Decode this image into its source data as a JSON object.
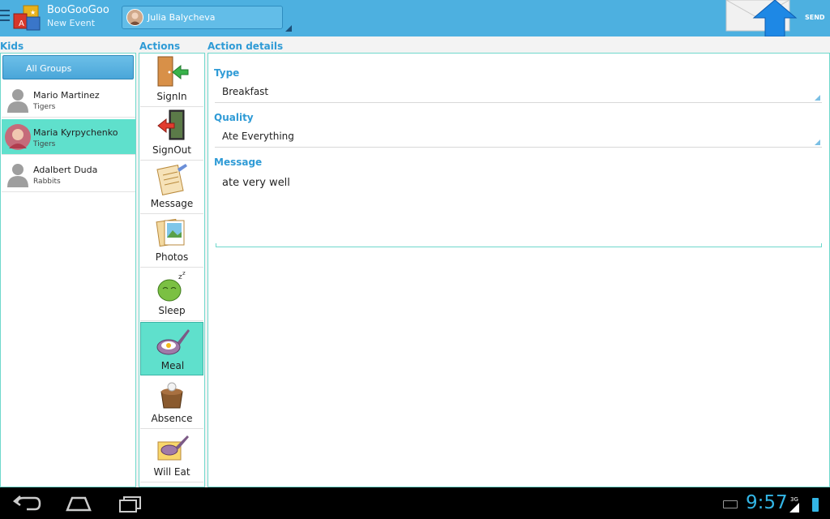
{
  "header": {
    "app_title": "BooGooGoo",
    "app_subtitle": "New Event",
    "user_name": "Julia Balycheva",
    "send_label": "SEND"
  },
  "sections": {
    "kids": "Kids",
    "actions": "Actions",
    "details": "Action details"
  },
  "kids": {
    "group_button": "All Groups",
    "items": [
      {
        "name": "Mario Martinez",
        "group": "Tigers",
        "selected": false
      },
      {
        "name": "Maria Kyrpychenko",
        "group": "Tigers",
        "selected": true
      },
      {
        "name": "Adalbert Duda",
        "group": "Rabbits",
        "selected": false
      }
    ]
  },
  "actions": {
    "items": [
      {
        "label": "SignIn",
        "icon": "sign-in-door-icon"
      },
      {
        "label": "SignOut",
        "icon": "sign-out-door-icon"
      },
      {
        "label": "Message",
        "icon": "message-notepad-icon"
      },
      {
        "label": "Photos",
        "icon": "photos-icon"
      },
      {
        "label": "Sleep",
        "icon": "sleep-icon"
      },
      {
        "label": "Meal",
        "icon": "meal-pan-icon",
        "selected": true
      },
      {
        "label": "Absence",
        "icon": "absence-icon"
      },
      {
        "label": "Will Eat",
        "icon": "will-eat-icon"
      }
    ]
  },
  "details": {
    "type_label": "Type",
    "type_value": "Breakfast",
    "quality_label": "Quality",
    "quality_value": "Ate Everything",
    "message_label": "Message",
    "message_value": "ate very well"
  },
  "statusbar": {
    "time": "9:57",
    "network": "3G"
  },
  "colors": {
    "actionbar": "#4db0e0",
    "accent": "#2f9bd6",
    "selection": "#5fe0cc",
    "clock": "#33b5e5"
  }
}
